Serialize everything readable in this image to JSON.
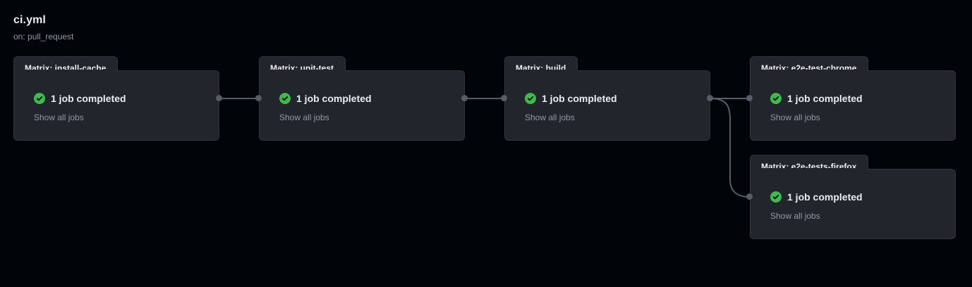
{
  "workflow": {
    "file_name": "ci.yml",
    "trigger": "on: pull_request"
  },
  "jobs": [
    {
      "id": "install-cache",
      "tab_label": "Matrix: install-cache",
      "status": "1 job completed",
      "link": "Show all jobs"
    },
    {
      "id": "unit-test",
      "tab_label": "Matrix: unit-test",
      "status": "1 job completed",
      "link": "Show all jobs"
    },
    {
      "id": "build",
      "tab_label": "Matrix: build",
      "status": "1 job completed",
      "link": "Show all jobs"
    },
    {
      "id": "e2e-test-chrome",
      "tab_label": "Matrix: e2e-test-chrome",
      "status": "1 job completed",
      "link": "Show all jobs"
    },
    {
      "id": "e2e-tests-firefox",
      "tab_label": "Matrix: e2e-tests-firefox",
      "status": "1 job completed",
      "link": "Show all jobs"
    }
  ],
  "colors": {
    "background": "#010409",
    "card": "#22262c",
    "border": "#30363d",
    "success": "#3fb950",
    "muted_text": "#9198a1",
    "connector": "#545d68"
  },
  "icons": {
    "status": "check-circle-icon"
  }
}
